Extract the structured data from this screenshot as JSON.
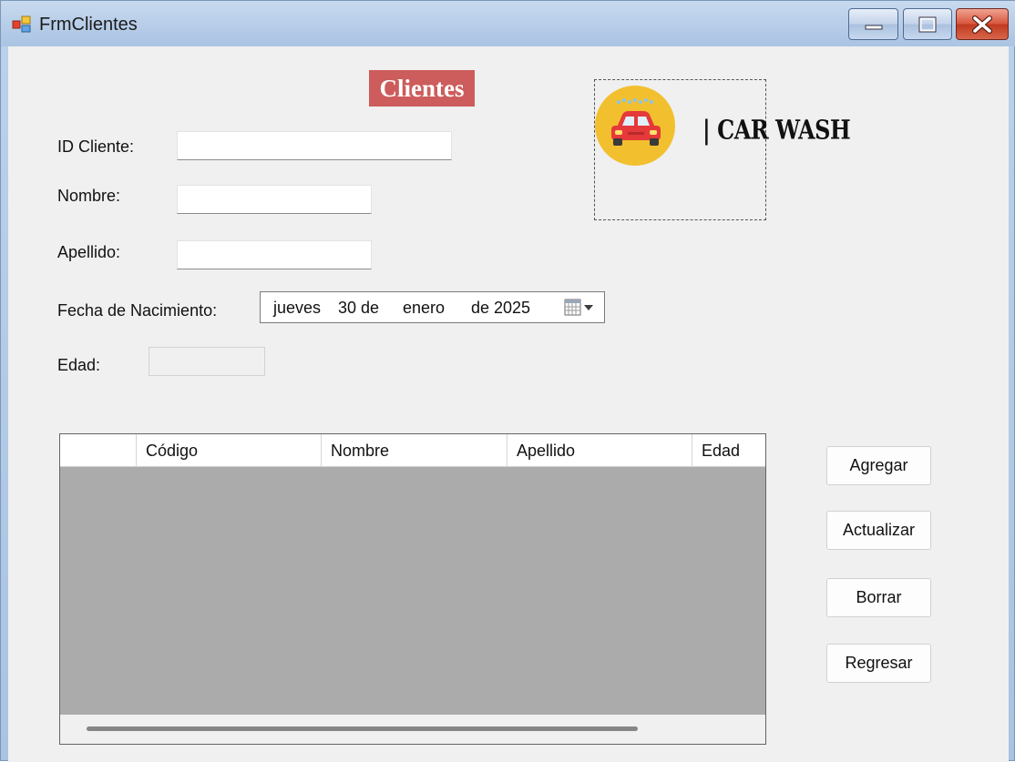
{
  "window": {
    "title": "FrmClientes",
    "icon": "app-form-icon"
  },
  "form": {
    "heading": "Clientes",
    "brand_text": "| CAR WASH",
    "logo_icon": "car-wash-logo",
    "accent_color": "#cd5c5c",
    "fields": {
      "id_cliente": {
        "label": "ID Cliente:",
        "value": ""
      },
      "nombre": {
        "label": "Nombre:",
        "value": ""
      },
      "apellido": {
        "label": "Apellido:",
        "value": ""
      },
      "fecha_nacimiento": {
        "label": "Fecha de Nacimiento:",
        "weekday": "jueves",
        "day": "30 de",
        "month": "enero",
        "year": "de 2025"
      },
      "edad": {
        "label": "Edad:",
        "value": ""
      }
    }
  },
  "grid": {
    "columns": [
      "",
      "Código",
      "Nombre",
      "Apellido",
      "Edad"
    ],
    "rows": []
  },
  "buttons": {
    "agregar": "Agregar",
    "actualizar": "Actualizar",
    "borrar": "Borrar",
    "regresar": "Regresar"
  }
}
